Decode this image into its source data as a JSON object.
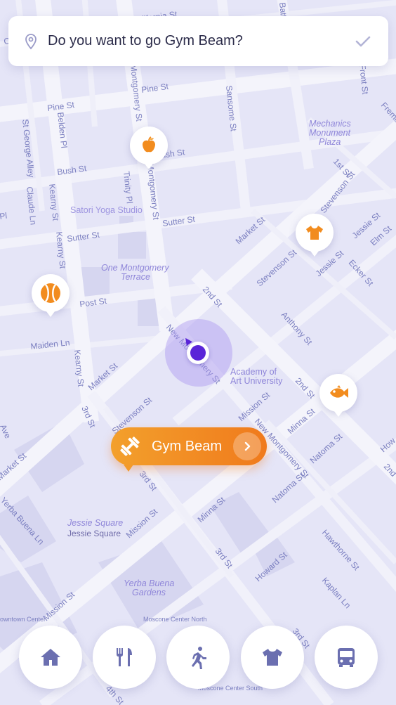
{
  "prompt": {
    "question": "Do you want to go Gym Beam?",
    "pin_icon": "map-pin-icon",
    "confirm_icon": "check-icon"
  },
  "streets": {
    "california": "California St",
    "pine1": "Pine St",
    "pine2": "Pine St",
    "bush1": "Bush St",
    "bush2": "Bush St",
    "sutter1": "Sutter St",
    "sutter2": "Sutter St",
    "post": "Post St",
    "maiden": "Maiden Ln",
    "kearny1": "Kearny St",
    "kearny2": "Kearny St",
    "kearny3": "Kearny St",
    "montgomery1": "Montgomery St",
    "montgomery2": "Montgomery St",
    "sansome": "Sansome St",
    "battery": "Battery St",
    "front": "Front St",
    "trinity": "Trinity Pl",
    "belden": "Belden Pl",
    "stgeorge": "St George Alley",
    "claude": "Claude Ln",
    "market1": "Market St",
    "market2": "Market St",
    "market3": "Market St",
    "first": "1st St",
    "second1": "2nd St",
    "second2": "2nd St",
    "third1": "3rd St",
    "third2": "3rd St",
    "third3": "3rd St",
    "third4": "3rd St",
    "stevenson1": "Stevenson St",
    "stevenson2": "Stevenson St",
    "stevenson3": "Stevenson St",
    "jessie1": "Jessie St",
    "jessie2": "Jessie St",
    "ecker": "Ecker St",
    "elm": "Elm St",
    "anthony": "Anthony St",
    "newmont1": "New Montgomery St",
    "newmont2": "New Montgomery St",
    "mission1": "Mission St",
    "mission2": "Mission St",
    "mission3": "Mission St",
    "minna1": "Minna St",
    "minna2": "Minna St",
    "natoma1": "Natoma St",
    "natoma2": "Natoma St",
    "howard": "Howard St",
    "hawthorne": "Hawthorne St",
    "kaplan": "Kaplan Ln",
    "yerbabuena": "Yerba Buena Ln",
    "fourth": "4th St",
    "fremont": "Fremont St",
    "ave": "Ave",
    "how": "How",
    "second3": "2nd",
    "pl": "Pl"
  },
  "places": {
    "mechanics": "Mechanics Monument Plaza",
    "satori": "Satori Yoga Studio",
    "onemontgomery": "One Montgomery Terrace",
    "academy": "Academy of Art University",
    "jessiesquare_it": "Jessie Square",
    "jessiesquare": "Jessie Square",
    "yerbagardens": "Yerba Buena Gardens",
    "moscone_n": "Moscone Center North",
    "moscone_s": "Moscone Center South",
    "downtown": "owntown Center"
  },
  "markers": [
    {
      "name": "apple-marker",
      "icon": "apple-icon"
    },
    {
      "name": "tshirt-marker",
      "icon": "tshirt-icon"
    },
    {
      "name": "tennis-marker",
      "icon": "tennis-ball-icon"
    },
    {
      "name": "fish-marker",
      "icon": "fish-icon"
    }
  ],
  "destination": {
    "label": "Gym Beam",
    "icon": "dumbbell-icon",
    "action_icon": "chevron-right-icon"
  },
  "nav": [
    {
      "name": "home",
      "icon": "home-icon"
    },
    {
      "name": "food",
      "icon": "fork-knife-icon"
    },
    {
      "name": "activity",
      "icon": "running-icon"
    },
    {
      "name": "clothes",
      "icon": "tshirt-icon"
    },
    {
      "name": "transit",
      "icon": "bus-icon"
    }
  ],
  "colors": {
    "map_bg": "#e5e5f7",
    "accent_orange": "#f07a1c",
    "accent_purple": "#5a25d8",
    "nav_icon": "#6b6fb0"
  }
}
